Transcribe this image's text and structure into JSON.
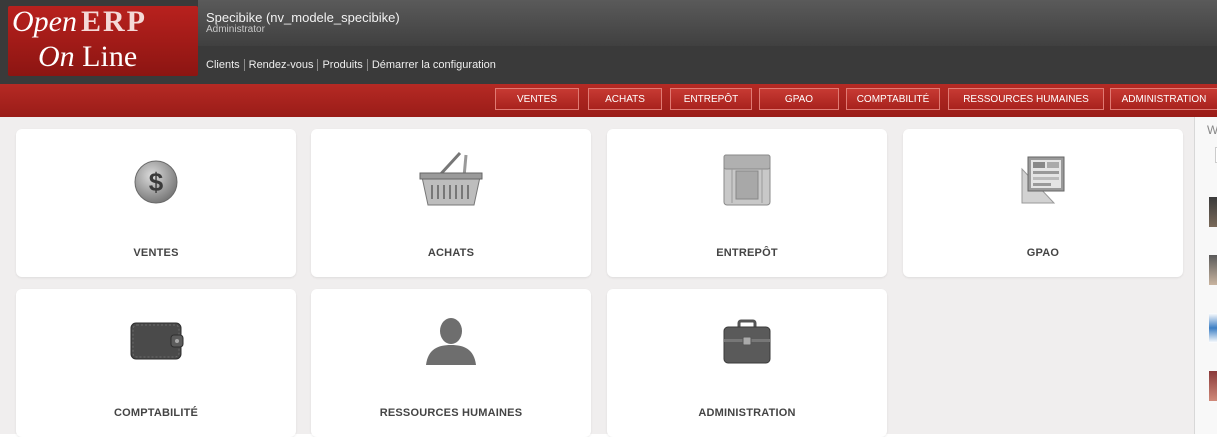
{
  "logo": {
    "line1": "Open",
    "line1b": "ERP",
    "line2": "On",
    "line2b": "Line"
  },
  "header": {
    "company": "Specibike (nv_modele_specibike)",
    "user": "Administrator",
    "shortcuts": [
      "Clients",
      "Rendez-vous",
      "Produits",
      "Démarrer la configuration"
    ]
  },
  "menu": [
    "VENTES",
    "ACHATS",
    "ENTREPÔT",
    "GPAO",
    "COMPTABILITÉ",
    "RESSOURCES HUMAINES",
    "ADMINISTRATION"
  ],
  "tiles": [
    {
      "label": "VENTES",
      "icon": "dollar-coin-icon"
    },
    {
      "label": "ACHATS",
      "icon": "shopping-basket-icon"
    },
    {
      "label": "ENTREPÔT",
      "icon": "warehouse-crate-icon"
    },
    {
      "label": "GPAO",
      "icon": "blueprint-window-icon"
    },
    {
      "label": "COMPTABILITÉ",
      "icon": "wallet-icon"
    },
    {
      "label": "RESSOURCES HUMAINES",
      "icon": "person-silhouette-icon"
    },
    {
      "label": "ADMINISTRATION",
      "icon": "briefcase-icon"
    }
  ],
  "right_panel": {
    "letter": "W"
  },
  "colors": {
    "brand_red": "#a8221d",
    "header_dark": "#3a3a3a",
    "tile_bg": "#ffffff",
    "area_bg": "#f0eeee"
  }
}
